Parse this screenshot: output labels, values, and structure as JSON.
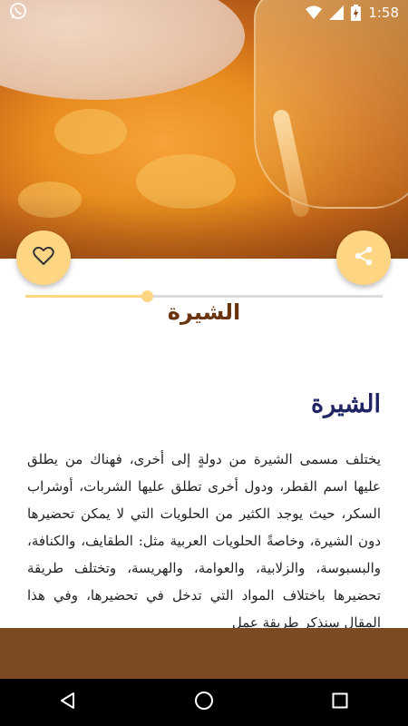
{
  "status_bar": {
    "time": "1:58",
    "left_icon": "whatsapp-icon",
    "right_icons": [
      "wifi-icon",
      "signal-icon",
      "battery-charging-icon"
    ]
  },
  "hero": {
    "subject": "syrup-poured-over-pastry"
  },
  "actions": {
    "favorite_icon": "heart-outline-icon",
    "share_icon": "share-icon",
    "accent_color": "#fdd583"
  },
  "progress": {
    "value_fraction": 0.34
  },
  "recipe": {
    "title": "الشيرة",
    "section_heading": "الشيرة",
    "body": "يختلف مسمى الشيرة من دولةٍ إلى أخرى، فهناك من يطلق عليها اسم القطر، ودول أخرى تطلق عليها الشربات، أوشراب السكر، حيث يوجد الكثير من الحلويات التي لا يمكن تحضيرها دون الشيرة، وخاصةً الحلويات العربية مثل: الطقايف، والكنافة، والبسبوسة، والزلابية، والعوامة، والهريسة، وتختلف طريقة تحضيرها باختلاف المواد التي تدخل في تحضيرها، وفي هذا المقال سنذكر طريقة عمل"
  },
  "colors": {
    "title": "#6b3410",
    "heading": "#1f2563",
    "footer": "#7a4a24"
  },
  "nav": [
    "back-icon",
    "home-icon",
    "recents-icon"
  ]
}
